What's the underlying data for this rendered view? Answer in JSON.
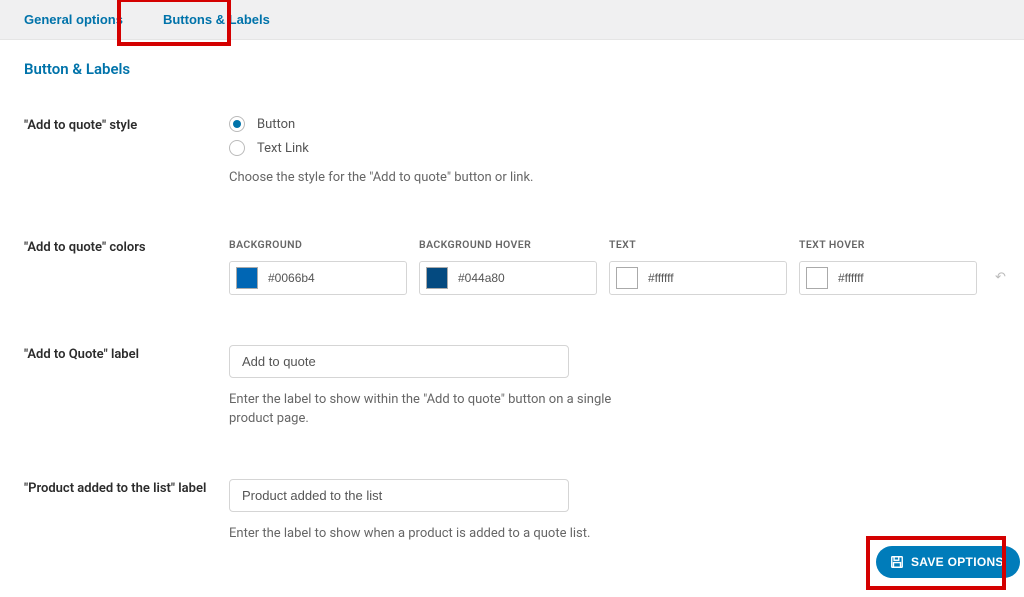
{
  "tabs": [
    {
      "label": "General options",
      "active": false
    },
    {
      "label": "Buttons & Labels",
      "active": true
    }
  ],
  "page_title": "Button & Labels",
  "style_field": {
    "label": "\"Add to quote\" style",
    "options": [
      {
        "label": "Button",
        "checked": true
      },
      {
        "label": "Text Link",
        "checked": false
      }
    ],
    "help": "Choose the style for the \"Add to quote\" button or link."
  },
  "colors_field": {
    "label": "\"Add to quote\" colors",
    "items": [
      {
        "name": "BACKGROUND",
        "hex": "#0066b4",
        "swatch": "#0066b4"
      },
      {
        "name": "BACKGROUND HOVER",
        "hex": "#044a80",
        "swatch": "#044a80"
      },
      {
        "name": "TEXT",
        "hex": "#ffffff",
        "swatch": "#ffffff"
      },
      {
        "name": "TEXT HOVER",
        "hex": "#ffffff",
        "swatch": "#ffffff"
      }
    ]
  },
  "quote_label_field": {
    "label": "\"Add to Quote\" label",
    "value": "Add to quote",
    "help": "Enter the label to show within the \"Add to quote\" button on a single product page."
  },
  "added_label_field": {
    "label": "\"Product added to the list\" label",
    "value": "Product added to the list",
    "help": "Enter the label to show when a product is added to a quote list."
  },
  "save_button": "SAVE OPTIONS"
}
